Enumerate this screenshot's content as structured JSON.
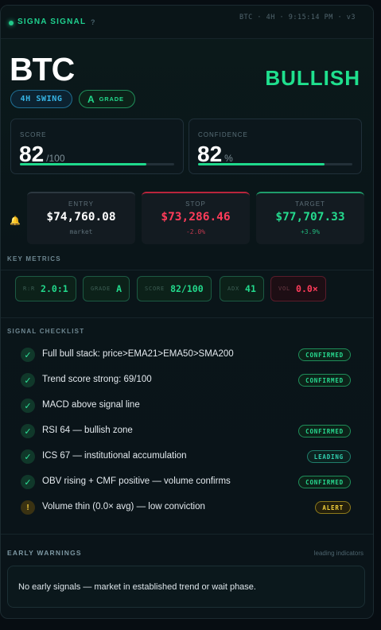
{
  "header": {
    "brand": "SIGNA SIGNAL",
    "help": "?",
    "meta": "BTC · 4H · 9:15:14 PM · v3"
  },
  "hero": {
    "ticker": "BTC",
    "bias": "BULLISH",
    "timeframe_pill": "4H SWING",
    "grade_letter": "A",
    "grade_label": "GRADE"
  },
  "score": {
    "label": "SCORE",
    "value": "82",
    "unit": "/100",
    "fill": 0.82
  },
  "confidence": {
    "label": "CONFIDENCE",
    "value": "82",
    "unit": "%",
    "fill": 0.82
  },
  "prices": {
    "entry": {
      "label": "ENTRY",
      "value": "$74,760.08",
      "sub": "market"
    },
    "stop": {
      "label": "STOP",
      "value": "$73,286.46",
      "sub": "-2.0%"
    },
    "target": {
      "label": "TARGET",
      "value": "$77,707.33",
      "sub": "+3.9%"
    }
  },
  "key_metrics": {
    "title": "KEY METRICS",
    "chips": [
      {
        "key": "R:R",
        "value": "2.0:1"
      },
      {
        "key": "GRADE",
        "value": "A"
      },
      {
        "key": "SCORE",
        "value": "82/100"
      },
      {
        "key": "ADX",
        "value": "41"
      },
      {
        "key": "VOL",
        "value": "0.0×"
      }
    ]
  },
  "checklist": {
    "title": "SIGNAL CHECKLIST",
    "items": [
      {
        "text": "Full bull stack: price>EMA21>EMA50>SMA200",
        "badge": "CONFIRMED",
        "icon": "✓"
      },
      {
        "text": "Trend score strong: 69/100",
        "badge": "CONFIRMED",
        "icon": "✓"
      },
      {
        "text": "MACD above signal line",
        "badge": "",
        "icon": "✓"
      },
      {
        "text": "RSI 64 — bullish zone",
        "badge": "CONFIRMED",
        "icon": "✓"
      },
      {
        "text": "ICS 67 — institutional accumulation",
        "badge": "LEADING",
        "icon": "✓"
      },
      {
        "text": "OBV rising + CMF positive — volume confirms",
        "badge": "CONFIRMED",
        "icon": "✓"
      },
      {
        "text": "Volume thin (0.0× avg) — low conviction",
        "badge": "ALERT",
        "icon": "!"
      }
    ]
  },
  "early_warnings": {
    "title": "EARLY WARNINGS",
    "note": "leading indicators",
    "message": "No early signals — market in established trend or wait phase."
  },
  "colors": {
    "accent": "#1fe08e",
    "danger": "#ff3c5a",
    "info": "#37b5e6",
    "warn": "#f1c93a"
  }
}
